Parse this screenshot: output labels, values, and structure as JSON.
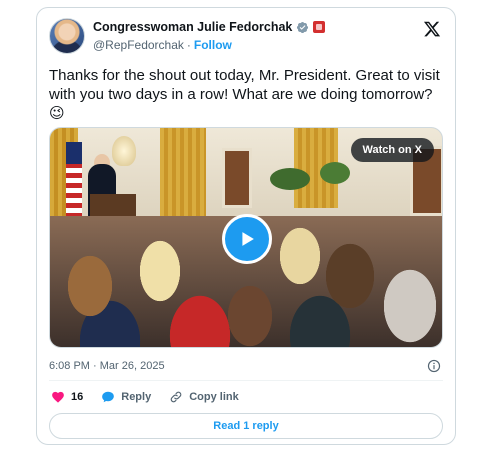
{
  "author": {
    "name": "Congresswoman Julie Fedorchak",
    "handle": "@RepFedorchak",
    "separator": "·",
    "follow_label": "Follow",
    "avatar_icon": "profile-avatar",
    "verified_icon": "verified-badge-icon",
    "affiliation_icon": "house-seal-badge-icon"
  },
  "platform_icon": "x-logo-icon",
  "tweet": {
    "text": "Thanks for the shout out today, Mr. President. Great to visit with you two days in a row! What are we doing tomorrow? 😉"
  },
  "media": {
    "watch_label": "Watch on X",
    "play_icon": "play-icon"
  },
  "meta": {
    "timestamp": "6:08 PM · Mar 26, 2025",
    "info_icon": "info-icon"
  },
  "actions": {
    "like_count": "16",
    "reply_label": "Reply",
    "copy_link_label": "Copy link"
  },
  "footer": {
    "read_replies_label": "Read 1 reply"
  },
  "colors": {
    "accent": "#1d9bf0",
    "like": "#f91880",
    "text": "#0f1419",
    "muted": "#536471",
    "border": "#cfd9de"
  }
}
